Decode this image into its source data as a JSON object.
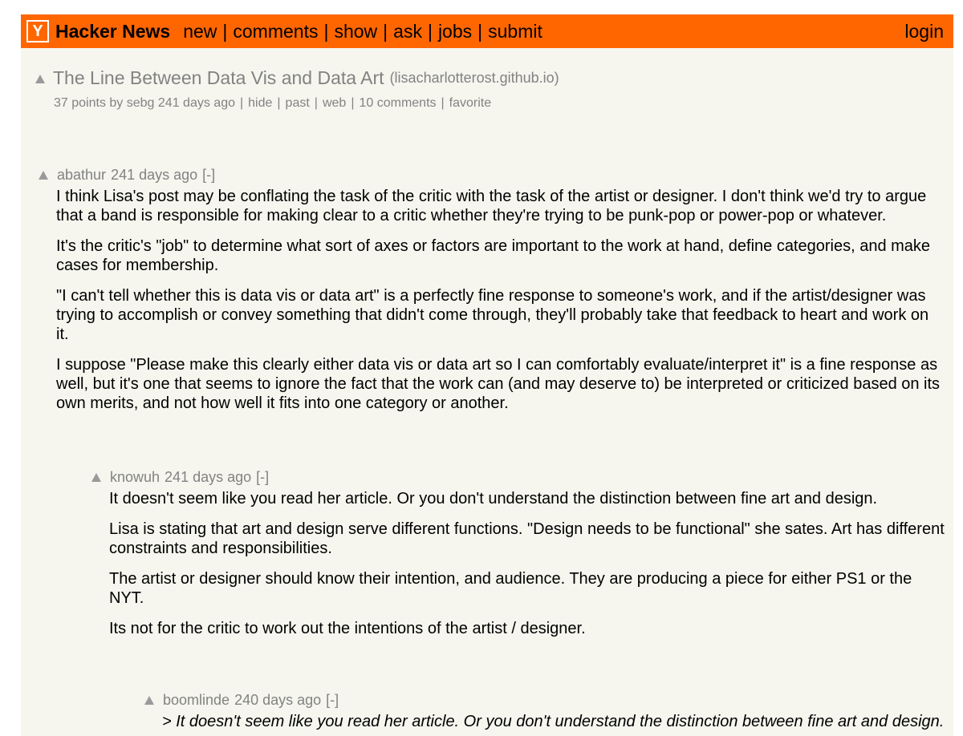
{
  "header": {
    "logo": "Y",
    "site_name": "Hacker News",
    "nav": [
      "new",
      "comments",
      "show",
      "ask",
      "jobs",
      "submit"
    ],
    "separator": "|",
    "login": "login"
  },
  "story": {
    "title": "The Line Between Data Vis and Data Art",
    "site": "(lisacharlotterost.github.io)",
    "points": "37 points",
    "by": "by",
    "user": "sebg",
    "age": "241 days ago",
    "links": [
      "hide",
      "past",
      "web",
      "10 comments",
      "favorite"
    ]
  },
  "comments": [
    {
      "user": "abathur",
      "age": "241 days ago",
      "toggle": "[-]",
      "paragraphs": [
        "I think Lisa's post may be conflating the task of the critic with the task of the artist or designer. I don't think we'd try to argue that a band is responsible for making clear to a critic whether they're trying to be punk-pop or power-pop or whatever.",
        "It's the critic's \"job\" to determine what sort of axes or factors are important to the work at hand, define categories, and make cases for membership.",
        "\"I can't tell whether this is data vis or data art\" is a perfectly fine response to someone's work, and if the artist/designer was trying to accomplish or convey something that didn't come through, they'll probably take that feedback to heart and work on it.",
        "I suppose \"Please make this clearly either data vis or data art so I can comfortably evaluate/interpret it\" is a fine response as well, but it's one that seems to ignore the fact that the work can (and may deserve to) be interpreted or criticized based on its own merits, and not how well it fits into one category or another."
      ]
    },
    {
      "user": "knowuh",
      "age": "241 days ago",
      "toggle": "[-]",
      "paragraphs": [
        "It doesn't seem like you read her article. Or you don't understand the distinction between fine art and design.",
        "Lisa is stating that art and design serve different functions. \"Design needs to be functional\" she sates. Art has different constraints and responsibilities.",
        "The artist or designer should know their intention, and audience. They are producing a piece for either PS1 or the NYT.",
        "Its not for the critic to work out the intentions of the artist / designer."
      ]
    },
    {
      "user": "boomlinde",
      "age": "240 days ago",
      "toggle": "[-]",
      "paragraphs": [
        "> It doesn't seem like you read her article. Or you don't understand the distinction between fine art and design."
      ]
    }
  ]
}
